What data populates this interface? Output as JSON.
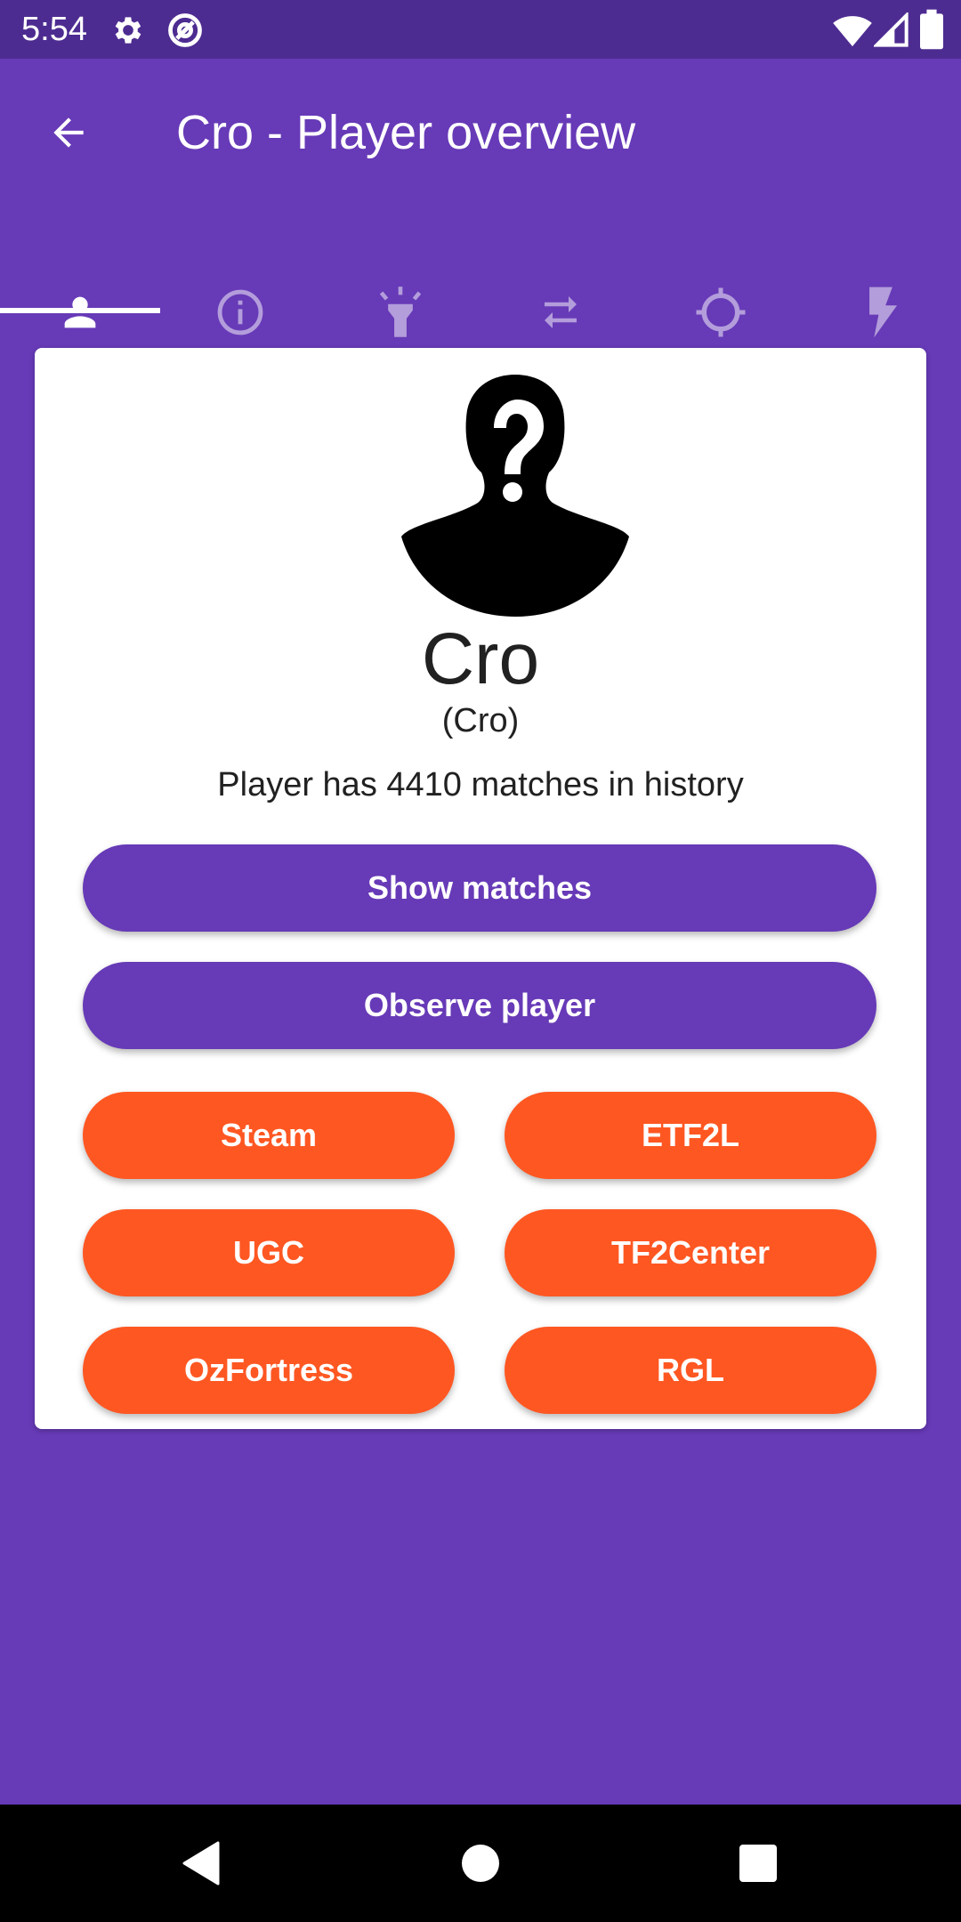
{
  "status_bar": {
    "time": "5:54",
    "icons": [
      "gear-icon",
      "at-sign-icon",
      "wifi-icon",
      "signal-icon",
      "battery-icon"
    ]
  },
  "app_bar": {
    "title": "Cro - Player overview",
    "back_icon": "arrow-left-icon"
  },
  "tabs": [
    {
      "icon": "person-icon",
      "selected": true
    },
    {
      "icon": "info-icon",
      "selected": false
    },
    {
      "icon": "flashlight-icon",
      "selected": false
    },
    {
      "icon": "swap-icon",
      "selected": false
    },
    {
      "icon": "crosshair-icon",
      "selected": false
    },
    {
      "icon": "lightning-icon",
      "selected": false
    }
  ],
  "player": {
    "name": "Cro",
    "alias": "(Cro)",
    "matches_text": "Player has 4410 matches in history",
    "avatar_icon": "unknown-person-avatar"
  },
  "actions": {
    "show_matches": "Show matches",
    "observe_player": "Observe player"
  },
  "links": {
    "steam": "Steam",
    "etf2l": "ETF2L",
    "ugc": "UGC",
    "tf2center": "TF2Center",
    "ozfortress": "OzFortress",
    "rgl": "RGL"
  },
  "nav_bar": {
    "icons": [
      "back-triangle-icon",
      "home-circle-icon",
      "recents-square-icon"
    ]
  },
  "colors": {
    "primary": "#673ab7",
    "primary_dark": "#4d2c91",
    "accent": "#ff5722",
    "card": "#ffffff",
    "tab_inactive": "#b39ddb"
  }
}
